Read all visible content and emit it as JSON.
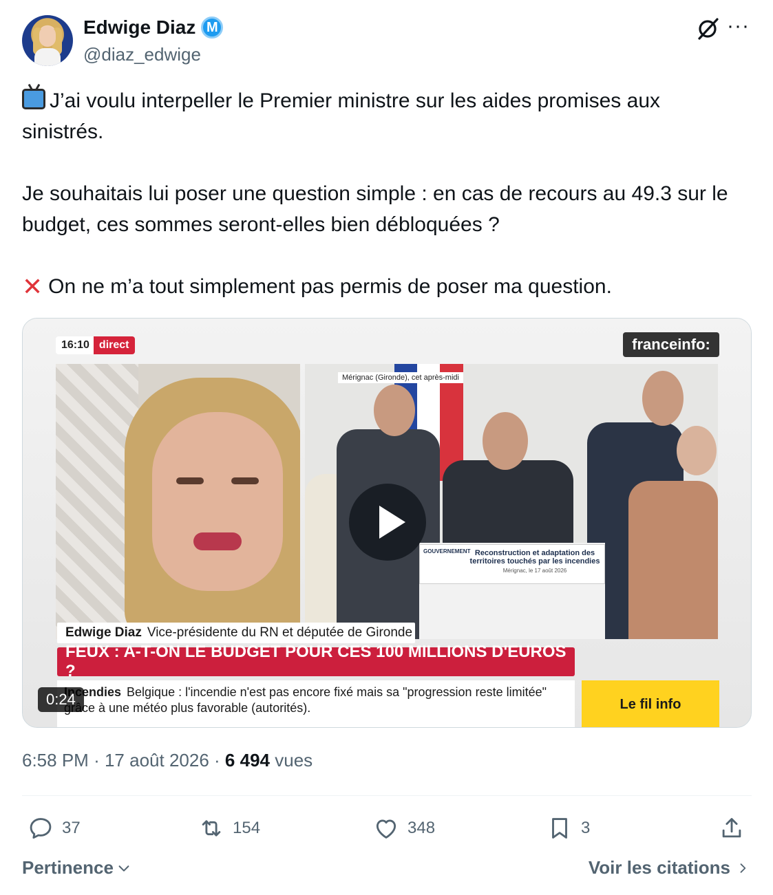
{
  "author": {
    "name": "Edwige Diaz",
    "handle": "@diaz_edwige",
    "verified_icon": "verified-badge-icon"
  },
  "header_icons": {
    "grok": "grok-slash-icon",
    "more": "···"
  },
  "tweet": {
    "line1": "J’ai voulu interpeller le Premier ministre sur les aides promises aux sinistrés.",
    "line2": "Je souhaitais lui poser une question simple : en cas de recours au 49.3 sur le budget, ces sommes seront-elles bien débloquées ?",
    "line3": "On ne m’a tout simplement pas permis de poser ma question."
  },
  "video": {
    "duration": "0:24",
    "time": "16:10",
    "live_label": "direct",
    "channel": "franceinfo:",
    "location": "Mérignac (Gironde), cet après-midi",
    "podium_org": "GOUVERNEMENT",
    "podium_text": "Reconstruction et adaptation des territoires touchés par les incendies",
    "podium_date": "Mérignac, le 17 août 2026",
    "lower_third_name": "Edwige Diaz",
    "lower_third_role": "Vice-présidente du RN et députée de Gironde",
    "headline": "FEUX : A-T-ON LE BUDGET POUR CES 100 MILLIONS D'EUROS ?",
    "ticker_tag": "Incendies",
    "ticker_text": "Belgique : l'incendie n'est pas encore fixé mais sa \"progression reste limitée\" grâce à une météo plus favorable (autorités).",
    "fil_info": "Le fil info"
  },
  "meta": {
    "time": "6:58 PM",
    "separator": "·",
    "date": "17 août 2026",
    "views": "6 494",
    "views_label": "vues"
  },
  "actions": {
    "replies": "37",
    "reposts": "154",
    "likes": "348",
    "bookmarks": "3"
  },
  "footer": {
    "sort": "Pertinence",
    "quotes": "Voir les citations"
  },
  "colors": {
    "text": "#0f1419",
    "secondary": "#536471",
    "verified": "#1d9bf0",
    "headline_red": "#cc1f3d",
    "fil_info_yellow": "#ffd21f"
  }
}
